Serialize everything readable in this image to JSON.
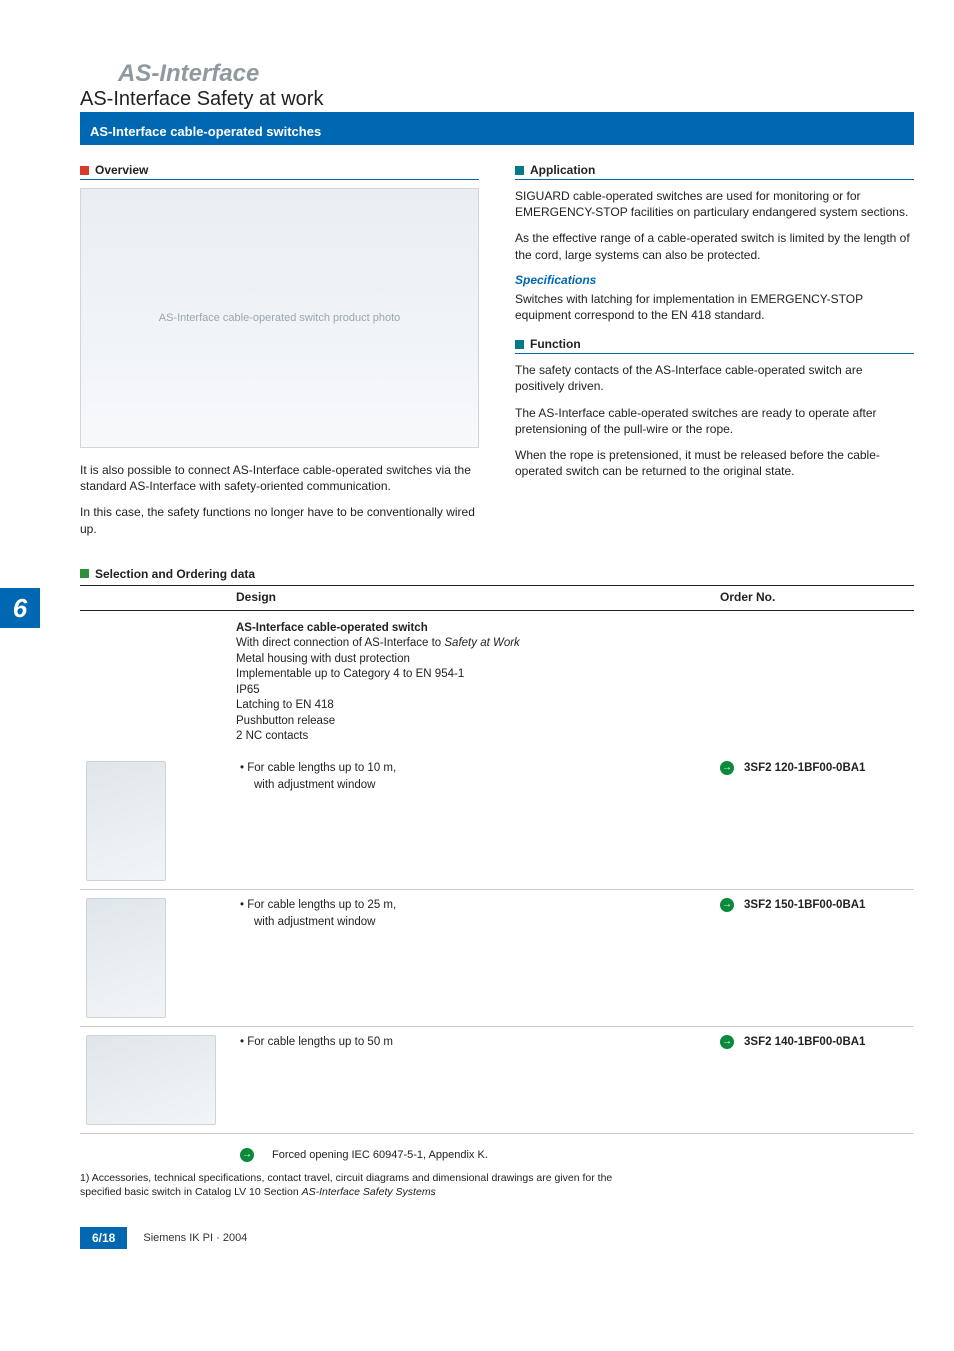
{
  "side_tab": "6",
  "title": {
    "main": "AS-Interface",
    "sub": "AS-Interface Safety at work"
  },
  "header_bar": "AS-Interface cable-operated switches",
  "overview": {
    "heading": "Overview",
    "image_alt": "AS-Interface cable-operated switch product photo",
    "p1": "It is also possible to connect AS-Interface cable-operated switches via the standard AS-Interface with safety-oriented communication.",
    "p2": "In this case, the safety functions no longer have to be conventionally wired up."
  },
  "application": {
    "heading": "Application",
    "p1": "SIGUARD cable-operated switches are used for monitoring or for EMERGENCY-STOP facilities on particulary endangered system sections.",
    "p2": "As the effective range of a cable-operated switch is limited by the length of the cord, large systems can also be protected.",
    "spec_heading": "Specifications",
    "p3": "Switches with latching for implementation in EMERGENCY-STOP equipment correspond to the EN 418 standard."
  },
  "function": {
    "heading": "Function",
    "p1": "The safety contacts of the AS-Interface cable-operated switch are positively driven.",
    "p2": "The AS-Interface cable-operated switches are ready to operate after pretensioning of the pull-wire or the rope.",
    "p3": "When the rope is pretensioned, it must be released before the cable-operated switch can be returned to the original state."
  },
  "ordering": {
    "heading": "Selection and Ordering data",
    "col_design": "Design",
    "col_order": "Order No.",
    "intro": {
      "title": "AS-Interface cable-operated switch",
      "lines": [
        "With direct connection of AS-Interface to ",
        "Safety at Work",
        "Metal housing with dust protection",
        "Implementable up to Category 4 to EN 954-1",
        "IP65",
        "Latching to EN 418",
        "Pushbutton release",
        "2 NC contacts"
      ]
    },
    "rows": [
      {
        "bullet": "For cable lengths up to 10 m,",
        "sub": "with adjustment window",
        "order": "3SF2 120-1BF00-0BA1"
      },
      {
        "bullet": "For cable lengths up to 25 m,",
        "sub": "with adjustment window",
        "order": "3SF2 150-1BF00-0BA1"
      },
      {
        "bullet": "For cable lengths up to 50 m",
        "sub": "",
        "order": "3SF2 140-1BF00-0BA1"
      }
    ],
    "legend": "Forced opening IEC 60947-5-1, Appendix K.",
    "footnote_lead": "1) ",
    "footnote": "Accessories, technical specifications, contact travel, circuit diagrams and dimensional drawings are given for the specified basic switch in Catalog LV 10 Section ",
    "footnote_ital": "AS-Interface Safety Systems"
  },
  "footer": {
    "page": "6/18",
    "text": "Siemens IK PI · 2004"
  },
  "chart_data": {
    "type": "table",
    "title": "Selection and Ordering data — AS-Interface cable-operated switch",
    "columns": [
      "Design",
      "Order No."
    ],
    "rows": [
      {
        "Design": "For cable lengths up to 10 m, with adjustment window",
        "Order No.": "3SF2 120-1BF00-0BA1"
      },
      {
        "Design": "For cable lengths up to 25 m, with adjustment window",
        "Order No.": "3SF2 150-1BF00-0BA1"
      },
      {
        "Design": "For cable lengths up to 50 m",
        "Order No.": "3SF2 140-1BF00-0BA1"
      }
    ],
    "notes": [
      "With direct connection of AS-Interface to Safety at Work",
      "Metal housing with dust protection",
      "Implementable up to Category 4 to EN 954-1",
      "IP65",
      "Latching to EN 418",
      "Pushbutton release",
      "2 NC contacts",
      "Forced opening IEC 60947-5-1, Appendix K."
    ]
  }
}
